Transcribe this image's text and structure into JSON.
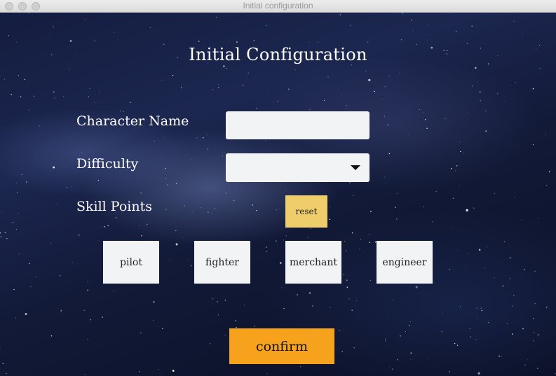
{
  "window": {
    "title": "Initial configuration"
  },
  "form": {
    "heading": "Initial Configuration",
    "character_name_label": "Character Name",
    "character_name_value": "",
    "difficulty_label": "Difficulty",
    "difficulty_value": "",
    "skill_points_label": "Skill Points",
    "reset_label": "reset",
    "skills": [
      {
        "label": "pilot"
      },
      {
        "label": "fighter"
      },
      {
        "label": "merchant"
      },
      {
        "label": "engineer"
      }
    ],
    "confirm_label": "confirm"
  },
  "colors": {
    "reset_button": "#efcd6a",
    "confirm_button": "#f6a21d",
    "field_background": "#f2f3f5"
  },
  "icons": {
    "difficulty_dropdown": "caret-down-icon"
  }
}
